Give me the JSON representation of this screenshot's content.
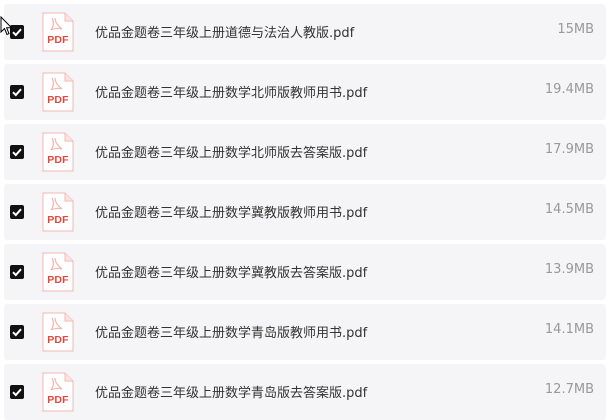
{
  "icon_text": "PDF",
  "files": [
    {
      "name": "优品金题卷三年级上册道德与法治人教版.pdf",
      "size": "15MB",
      "checked": true
    },
    {
      "name": "优品金题卷三年级上册数学北师版教师用书.pdf",
      "size": "19.4MB",
      "checked": true
    },
    {
      "name": "优品金题卷三年级上册数学北师版去答案版.pdf",
      "size": "17.9MB",
      "checked": true
    },
    {
      "name": "优品金题卷三年级上册数学冀教版教师用书.pdf",
      "size": "14.5MB",
      "checked": true
    },
    {
      "name": "优品金题卷三年级上册数学冀教版去答案版.pdf",
      "size": "13.9MB",
      "checked": true
    },
    {
      "name": "优品金题卷三年级上册数学青岛版教师用书.pdf",
      "size": "14.1MB",
      "checked": true
    },
    {
      "name": "优品金题卷三年级上册数学青岛版去答案版.pdf",
      "size": "12.7MB",
      "checked": true
    }
  ],
  "colors": {
    "row_bg": "#f5f5f7",
    "checkbox": "#111111",
    "pdf_red": "#e8463a",
    "name_text": "#333333",
    "size_text": "#999999"
  }
}
